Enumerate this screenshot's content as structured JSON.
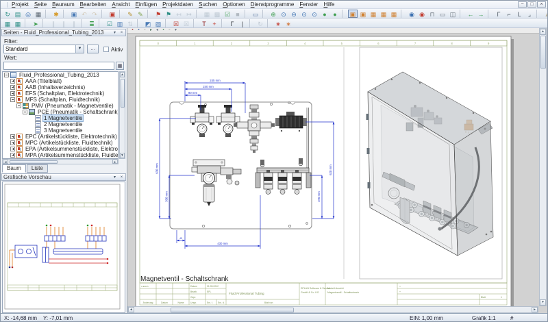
{
  "menubar": {
    "items": [
      "Projekt",
      "Seite",
      "Bauraum",
      "Bearbeiten",
      "Ansicht",
      "Einfügen",
      "Projektdaten",
      "Suchen",
      "Optionen",
      "Dienstprogramme",
      "Fenster",
      "Hilfe"
    ],
    "window_buttons": {
      "minimize": "−",
      "restore": "□",
      "close": "×"
    }
  },
  "toolbar_row1": [
    {
      "n": "sync",
      "g": "↻",
      "c": "#2e8f86"
    },
    {
      "n": "pages",
      "g": "▤",
      "c": "#2e8f86"
    },
    {
      "n": "world",
      "g": "◎",
      "c": "#3a6fb0"
    },
    {
      "n": "screen",
      "g": "▦",
      "c": "#5a6570"
    },
    {
      "sep": true
    },
    {
      "n": "favorites",
      "g": "✱",
      "c": "#d79b2a"
    },
    {
      "sep": true
    },
    {
      "n": "copy",
      "g": "▣",
      "c": "#4a7ab5"
    },
    {
      "n": "undo",
      "g": "↶",
      "c": "#b89a6a",
      "d": 1
    },
    {
      "n": "redo",
      "g": "↷",
      "c": "#b89a6a",
      "d": 1
    },
    {
      "sep": true
    },
    {
      "n": "stop",
      "g": "▣",
      "c": "#c23b2e"
    },
    {
      "sep": true
    },
    {
      "n": "edit",
      "g": "✎",
      "c": "#b8912f"
    },
    {
      "n": "edit-free",
      "g": "✎",
      "c": "#7fa04a"
    },
    {
      "sep": true
    },
    {
      "n": "flag-red",
      "g": "⚑",
      "c": "#c23b2e"
    },
    {
      "n": "flag-teal",
      "g": "⚑",
      "c": "#2e8f86"
    },
    {
      "n": "jump-back",
      "g": "↤",
      "c": "#8a9aa8",
      "d": 1
    },
    {
      "n": "jump-fwd",
      "g": "↦",
      "c": "#8a9aa8",
      "d": 1
    },
    {
      "sep": true
    },
    {
      "n": "grid-a",
      "g": "▦",
      "c": "#8a9aa8",
      "d": 1
    },
    {
      "n": "grid-b",
      "g": "▩",
      "c": "#8a9aa8",
      "d": 1
    },
    {
      "n": "check",
      "g": "☑",
      "c": "#3f9e4f"
    },
    {
      "n": "block",
      "g": "■",
      "c": "#6a737c",
      "d": 1
    },
    {
      "sep": true
    },
    {
      "n": "monitor",
      "g": "▭",
      "c": "#55719a"
    },
    {
      "sep": true
    },
    {
      "n": "zoom-in",
      "g": "⊕",
      "c": "#3f9e4f"
    },
    {
      "n": "zoom-window",
      "g": "⊙",
      "c": "#3a6fb0"
    },
    {
      "n": "zoom-out",
      "g": "⊖",
      "c": "#3a6fb0"
    },
    {
      "n": "zoom-page",
      "g": "⊙",
      "c": "#3a6fb0"
    },
    {
      "n": "zoom-prev",
      "g": "⊙",
      "c": "#3a6fb0"
    },
    {
      "n": "pan",
      "g": "●",
      "c": "#3f9e4f"
    },
    {
      "n": "pan-center",
      "g": "●",
      "c": "#3f9e4f"
    },
    {
      "sep": true
    },
    {
      "n": "win-1",
      "g": "▣",
      "c": "#d08030",
      "p": 1
    },
    {
      "n": "win-2",
      "g": "▣",
      "c": "#d08030"
    },
    {
      "n": "win-3",
      "g": "▦",
      "c": "#d08030"
    },
    {
      "n": "win-4",
      "g": "▦",
      "c": "#d08030"
    },
    {
      "n": "win-5",
      "g": "▦",
      "c": "#d08030"
    },
    {
      "sep": true
    },
    {
      "n": "pin-blue",
      "g": "◉",
      "c": "#3a6fb0"
    },
    {
      "n": "pin-red",
      "g": "◉",
      "c": "#c23b2e"
    },
    {
      "n": "clamp",
      "g": "⊓",
      "c": "#6a737c"
    },
    {
      "n": "frame",
      "g": "▭",
      "c": "#6a737c"
    },
    {
      "n": "frame-2",
      "g": "◫",
      "c": "#6a737c"
    },
    {
      "sep": true
    },
    {
      "n": "prev-page",
      "g": "←",
      "c": "#3f9e4f"
    },
    {
      "n": "next-page",
      "g": "→",
      "c": "#3f9e4f"
    },
    {
      "sep": true
    },
    {
      "n": "corner-nw",
      "g": "Γ",
      "c": "#555f6a"
    },
    {
      "n": "corner-ne",
      "g": "⌐",
      "c": "#555f6a"
    },
    {
      "n": "corner-sw",
      "g": "L",
      "c": "#555f6a"
    },
    {
      "n": "corner-se",
      "g": "⌟",
      "c": "#555f6a"
    },
    {
      "sep": true
    },
    {
      "n": "warning",
      "g": "▲",
      "c": "#8a6a2a",
      "d": 1
    }
  ],
  "toolbar_row2": [
    {
      "n": "table-symbols",
      "g": "▦",
      "c": "#2e8f86"
    },
    {
      "n": "table-parts",
      "g": "▦",
      "c": "#2e8f86"
    },
    {
      "sep": true
    },
    {
      "n": "navigate",
      "g": "➤",
      "c": "#3f9e4f"
    },
    {
      "sep": true
    },
    {
      "n": "col-a",
      "g": "∥",
      "c": "#8a9aa8",
      "d": 1
    },
    {
      "n": "col-b",
      "g": "∥",
      "c": "#8a9aa8",
      "d": 1
    },
    {
      "n": "col-c",
      "g": "∥",
      "c": "#8a9aa8",
      "d": 1
    },
    {
      "sep": true
    },
    {
      "n": "device-list",
      "g": "≣",
      "c": "#3f9e4f"
    },
    {
      "sep": true
    },
    {
      "n": "check-project",
      "g": "☑",
      "c": "#2e8f86"
    },
    {
      "n": "page-macro",
      "g": "▥",
      "c": "#4a7ab5"
    },
    {
      "n": "sort",
      "g": "⇅",
      "c": "#8a9aa8",
      "d": 1
    },
    {
      "sep": true
    },
    {
      "n": "layer-a",
      "g": "◩",
      "c": "#4a7ab5"
    },
    {
      "n": "layer-b",
      "g": "▨",
      "c": "#4a7ab5"
    },
    {
      "sep": true
    },
    {
      "n": "delete-page",
      "g": "☒",
      "c": "#c23b2e"
    },
    {
      "n": "delete-all",
      "g": "☒",
      "c": "#8a9aa8",
      "d": 1
    },
    {
      "sep": true
    },
    {
      "n": "text-tool",
      "g": "T",
      "c": "#8b1a1a"
    },
    {
      "n": "insert-point",
      "g": "+",
      "c": "#c23b2e"
    },
    {
      "sep": true
    },
    {
      "n": "angle-tool",
      "g": "Γ",
      "c": "#3a3f45"
    },
    {
      "n": "line-tool",
      "g": "|",
      "c": "#3a3f45"
    },
    {
      "sep": true
    },
    {
      "n": "rotate",
      "g": "↻",
      "c": "#8a9aa8",
      "d": 1
    },
    {
      "sep": true
    },
    {
      "n": "snap-a",
      "g": "∗",
      "c": "#c23b2e"
    },
    {
      "n": "snap-b",
      "g": "∗",
      "c": "#d07030"
    }
  ],
  "mini_toolbar": [
    {
      "n": "nav-first",
      "g": "▪",
      "c": "#a03434"
    },
    {
      "n": "nav-prev",
      "g": "▪",
      "c": "#3860a8"
    },
    {
      "n": "sheet-a",
      "g": "▫",
      "c": "#888888"
    },
    {
      "n": "sheet-b",
      "g": "▸",
      "c": "#5a7a68"
    },
    {
      "n": "sheet-c",
      "g": "◂",
      "c": "#667088"
    },
    {
      "n": "ref-a",
      "g": "▪",
      "c": "#4a8860"
    },
    {
      "n": "ref-b",
      "g": "▫",
      "c": "#888888"
    },
    {
      "n": "ref-c",
      "g": "▾",
      "c": "#707a88"
    }
  ],
  "pages_panel": {
    "title": "Seiten - Fluid_Professional_Tubing_2013",
    "collapse_glyph": "▾",
    "close_glyph": "×",
    "filter_label": "Filter:",
    "filter_value": "Standard",
    "browse_button": "...",
    "aktiv_label": "Aktiv",
    "wert_label": "Wert:",
    "wert_value": "",
    "tabs": {
      "baum": "Baum",
      "liste": "Liste"
    },
    "tree": [
      {
        "label": "Fluid_Professional_Tubing_2013"
      },
      {
        "label": "AAA (Titelblatt)"
      },
      {
        "label": "AAB (Inhaltsverzeichnis)"
      },
      {
        "label": "EFS (Schaltplan, Elektrotechnik)"
      },
      {
        "label": "MFS (Schaltplan, Fluidtechnik)"
      },
      {
        "label": "PMV (Pneumatik - Magnetventile)"
      },
      {
        "label": "PCE (Pneumatik - Schaltschrank)"
      },
      {
        "label": "1 Magnetventile"
      },
      {
        "label": "2 Magnetventile"
      },
      {
        "label": "3 Magnetventile"
      },
      {
        "label": "EPC (Artikelstückliste, Elektrotechnik)"
      },
      {
        "label": "MPC (Artikelstückliste, Fluidtechnik)"
      },
      {
        "label": "EPA (Artikelsummenstückliste, Elektrotechnik)"
      },
      {
        "label": "MPA (Artikelsummenstückliste, Fluidtechnik)"
      },
      {
        "label": ""
      }
    ]
  },
  "preview_panel": {
    "title": "Grafische Vorschau"
  },
  "sheet": {
    "grid_refs": [
      "0",
      "1",
      "2",
      "3",
      "4",
      "5",
      "6",
      "7",
      "8",
      "9"
    ],
    "page_title": "Magnetventil - Schaltschrank",
    "page_id": "A.E02.5",
    "dims": {
      "top1": "245 mm",
      "top2": "240 mm",
      "top3": "90 mm",
      "bottom": "430 mm",
      "bottom_small": "45",
      "left_outer": "630 mm",
      "left_inner": "330 mm",
      "right_outer": "620 mm",
      "right_inner": "370 mm"
    },
    "titleblock": {
      "datum_label": "Datum",
      "datum_value": "21.05.2012",
      "bearb_label": "Bearb.",
      "bearb_value": "EPL",
      "gepr_label": "Gepr.",
      "aenderung_label": "Änderung",
      "datum2_label": "Datum",
      "name_label": "Name",
      "urspr_label": "Urspr.",
      "ersf_label": "Ers. f.",
      "ersd_label": "Ers. d.",
      "project_name": "Fluid Professional Tubing",
      "blatt_von_label": "Blatt von",
      "company_line1": "EPLAN Software & Service",
      "company_line2": "GmbH & Co. KG",
      "view_line1": "Modell-Ansicht",
      "view_line2": "Magnetventil - Schaltschrank",
      "eq_label": "=",
      "plus_label": "+",
      "blatt_label": "Blatt",
      "blatt_value": "1"
    }
  },
  "statusbar": {
    "x": "X: -14,68 mm",
    "y": "Y: -7,01 mm",
    "ein": "EIN: 1,00 mm",
    "grafik": "Grafik 1:1",
    "hash": "#"
  },
  "colors": {
    "dimension_blue": "#2233cc",
    "frame_green": "#93a56d",
    "accent_orange": "#d9822b"
  }
}
